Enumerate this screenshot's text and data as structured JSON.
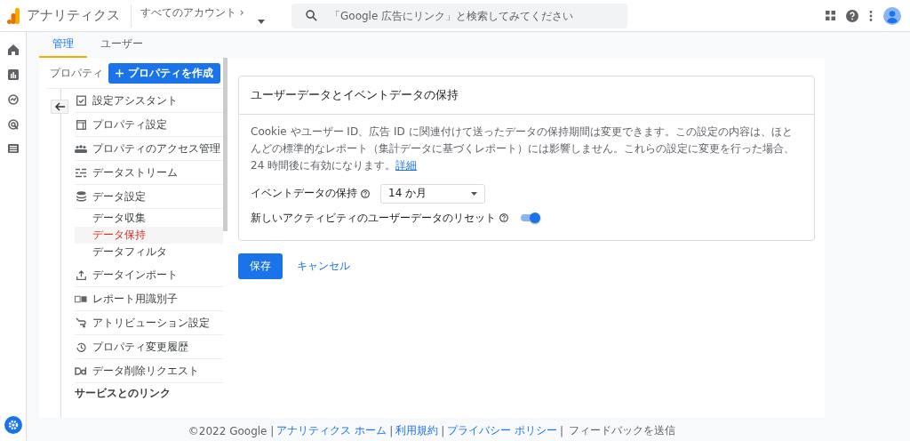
{
  "header": {
    "app_name": "アナリティクス",
    "account_label": "すべてのアカウント ›",
    "search": {
      "placeholder": "「Google 広告にリンク」と検索してみてください"
    }
  },
  "tabs": [
    {
      "label": "管理",
      "selected": true
    },
    {
      "label": "ユーザー",
      "selected": false
    }
  ],
  "property": {
    "label": "プロパティ",
    "create_button": "プロパティを作成"
  },
  "nav": [
    {
      "label": "設定アシスタント"
    },
    {
      "label": "プロパティ設定"
    },
    {
      "label": "プロパティのアクセス管理"
    },
    {
      "label": "データストリーム"
    },
    {
      "label": "データ設定",
      "children": [
        {
          "label": "データ収集",
          "selected": false
        },
        {
          "label": "データ保持",
          "selected": true
        },
        {
          "label": "データフィルタ",
          "selected": false
        }
      ]
    },
    {
      "label": "データインポート"
    },
    {
      "label": "レポート用識別子"
    },
    {
      "label": "アトリビューション設定"
    },
    {
      "label": "プロパティ変更履歴"
    },
    {
      "label": "データ削除リクエスト"
    }
  ],
  "nav_section": "サービスとのリンク",
  "card": {
    "title": "ユーザーデータとイベントデータの保持",
    "description": "Cookie やユーザー ID、広告 ID に関連付けて送ったデータの保持期間は変更できます。この設定の内容は、ほとんどの標準的なレポート（集計データに基づくレポート）には影響しません。これらの設定に変更を行った場合、24 時間後に有効になります。",
    "link": "詳細",
    "event_retention": {
      "label": "イベントデータの保持",
      "value": "14 か月"
    },
    "reset": {
      "label": "新しいアクティビティのユーザーデータのリセット",
      "on": true
    }
  },
  "buttons": {
    "save": "保存",
    "cancel": "キャンセル"
  },
  "footer": {
    "separator": "|",
    "copyright": "©2022 Google |",
    "links": [
      "アナリティクス ホーム",
      "利用規約",
      "プライバシー ポリシー"
    ],
    "feedback": "フィードバックを送信"
  }
}
